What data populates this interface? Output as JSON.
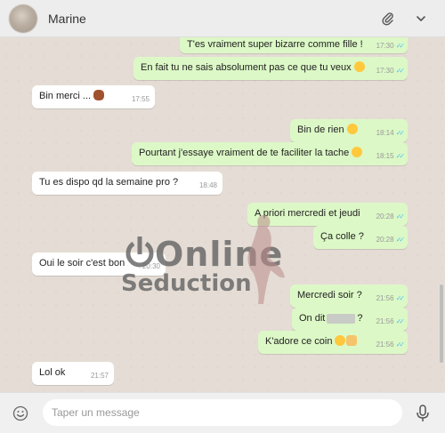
{
  "header": {
    "contact_name": "Marine",
    "attach_icon": "paperclip-icon",
    "menu_icon": "chevron-down-icon"
  },
  "messages": [
    {
      "dir": "out",
      "text": "T'es vraiment super bizarre comme fille !",
      "time": "17:30",
      "ticks": "✓✓"
    },
    {
      "dir": "out",
      "text": "En fait tu ne sais absolument pas ce que tu veux",
      "emoji": "smile",
      "time": "17:30",
      "ticks": "✓✓"
    },
    {
      "dir": "in",
      "text": "Bin merci ...",
      "emoji": "see-no-evil-monkey",
      "time": "17:55"
    },
    {
      "dir": "out",
      "text": "Bin de rien",
      "emoji": "laughing",
      "time": "18:14",
      "ticks": "✓✓"
    },
    {
      "dir": "out",
      "text": "Pourtant j'essaye vraiment de te faciliter la tache",
      "emoji": "smile",
      "time": "18:15",
      "ticks": "✓✓"
    },
    {
      "dir": "in",
      "text": "Tu es dispo qd la semaine pro ?",
      "time": "18:48"
    },
    {
      "dir": "out",
      "text": "A priori mercredi et jeudi",
      "time": "20:28",
      "ticks": "✓✓"
    },
    {
      "dir": "out",
      "text": "Ça colle ?",
      "time": "20:28",
      "ticks": "✓✓"
    },
    {
      "dir": "in",
      "text": "Oui le soir c'est bon",
      "time": "20:30"
    },
    {
      "dir": "out",
      "text": "Mercredi soir ?",
      "time": "21:56",
      "ticks": "✓✓"
    },
    {
      "dir": "out",
      "text_before": "On dit",
      "text_after": "?",
      "time": "21:56",
      "ticks": "✓✓"
    },
    {
      "dir": "out",
      "text": "K'adore ce coin",
      "emoji": "smile-wave",
      "time": "21:56",
      "ticks": "✓✓"
    },
    {
      "dir": "in",
      "text": "Lol ok",
      "time": "21:57"
    }
  ],
  "watermark": {
    "line1": "Online",
    "line2": "Seduction"
  },
  "footer": {
    "placeholder": "Taper un message",
    "emoji_icon": "emoji-icon",
    "mic_icon": "microphone-icon"
  },
  "colors": {
    "outgoing": "#dcf8c6",
    "incoming": "#ffffff",
    "read_ticks": "#4fc3f7",
    "chat_bg": "#e5ddd5"
  }
}
